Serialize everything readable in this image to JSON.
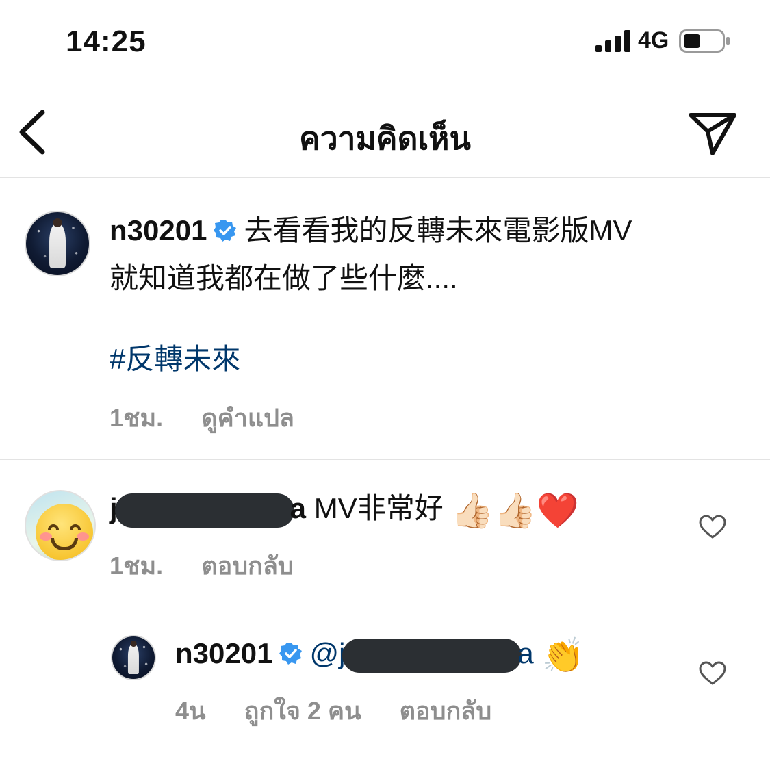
{
  "status_bar": {
    "time": "14:25",
    "network": "4G"
  },
  "header": {
    "title": "ความคิดเห็น"
  },
  "post": {
    "username": "n30201",
    "line1": "去看看我的反轉未來電影版MV",
    "line2": "就知道我都在做了些什麼....",
    "hashtag": "#反轉未來",
    "time": "1ชม.",
    "translate": "ดูคำแปล"
  },
  "comment": {
    "username_start": "j",
    "username_end": "a",
    "text": "MV非常好",
    "emojis": [
      "👍🏻",
      "👍🏻",
      "❤️"
    ],
    "time": "1ชม.",
    "reply": "ตอบกลับ"
  },
  "reply_comment": {
    "username": "n30201",
    "mention_start": "@j",
    "mention_end": "a",
    "emoji": "👏",
    "time": "4น",
    "likes": "ถูกใจ 2 คน",
    "reply": "ตอบกลับ"
  },
  "colors": {
    "link": "#00376b",
    "verified": "#3897f0",
    "meta": "#8e8e8e"
  }
}
